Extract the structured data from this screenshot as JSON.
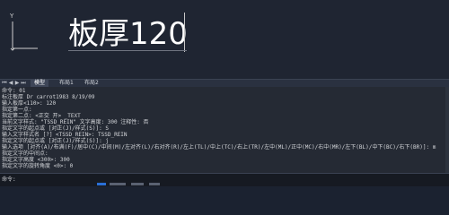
{
  "viewport": {
    "axis_label": "Y",
    "text_object": "板厚120"
  },
  "layout_tabs": {
    "items": [
      "模型",
      "布局1",
      "布局2"
    ]
  },
  "command_history": [
    "命令: 01",
    "标注板厚 Dr carrot1983 8/19/09",
    "输入板厚<110>: 120",
    "指定第一点:",
    "指定第二点: <正交 开>  _TEXT",
    "当前文字样式: \"TSSD_REIN\"  文字高度: 300  注释性: 否",
    "指定文字的起点或 [对正(J)/样式(S)]: S",
    "输入文字样式名 [?] <TSSD_REIN>: TSSD_REIN",
    "指定文字的起点或 [对正(J)/样式(S)]: j",
    "输入选项 [对齐(A)/布满(F)/居中(C)/中间(M)/左对齐(L)/右对齐(R)/左上(TL)/中上(TC)/右上(TR)/左中(ML)/正中(MC)/右中(MR)/左下(BL)/中下(BC)/右下(BR)]: m",
    "指定文字的中间点:",
    "指定文字高度 <300>: 300",
    "指定文字的旋转角度 <0>: 0"
  ],
  "command_prompt": "命令:",
  "colors": {
    "viewport_bg": "#1f2532",
    "cmd_bg": "#252a34",
    "status_blue": "#2a6fd6",
    "status_gray": "#5a6272"
  }
}
